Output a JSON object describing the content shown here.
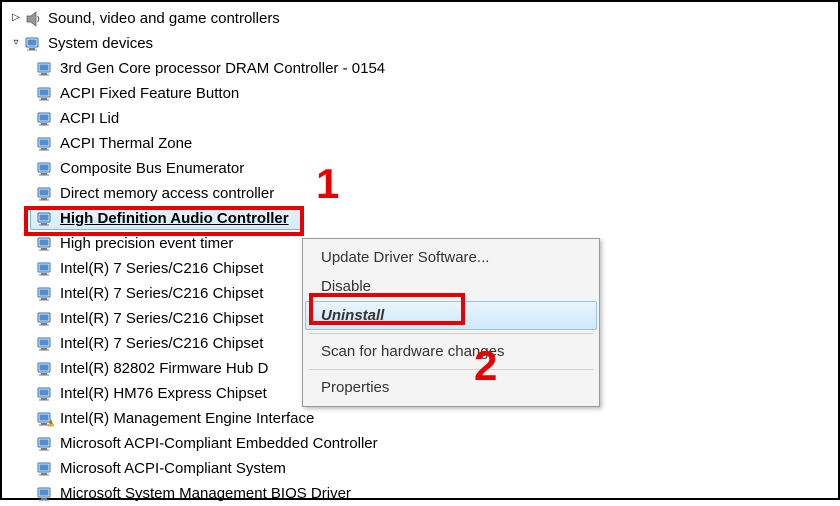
{
  "categories": [
    {
      "name": "Sound, video and game controllers",
      "expanded": false,
      "iconType": "speaker"
    },
    {
      "name": "System devices",
      "expanded": true,
      "iconType": "monitor"
    }
  ],
  "devices": [
    {
      "label": "3rd Gen Core processor DRAM Controller - 0154",
      "warn": false
    },
    {
      "label": "ACPI Fixed Feature Button",
      "warn": false
    },
    {
      "label": "ACPI Lid",
      "warn": false
    },
    {
      "label": "ACPI Thermal Zone",
      "warn": false
    },
    {
      "label": "Composite Bus Enumerator",
      "warn": false
    },
    {
      "label": "Direct memory access controller",
      "warn": false
    },
    {
      "label": "High Definition Audio Controller",
      "warn": false,
      "selected": true
    },
    {
      "label": "High precision event timer",
      "warn": false
    },
    {
      "label": "Intel(R) 7 Series/C216 Chipset ",
      "warn": false
    },
    {
      "label": "Intel(R) 7 Series/C216 Chipset ",
      "warn": false
    },
    {
      "label": "Intel(R) 7 Series/C216 Chipset ",
      "warn": false
    },
    {
      "label": "Intel(R) 7 Series/C216 Chipset ",
      "warn": false
    },
    {
      "label": "Intel(R) 82802 Firmware Hub D",
      "warn": false
    },
    {
      "label": "Intel(R) HM76 Express Chipset",
      "warn": false
    },
    {
      "label": "Intel(R) Management Engine Interface",
      "warn": true
    },
    {
      "label": "Microsoft ACPI-Compliant Embedded Controller",
      "warn": false
    },
    {
      "label": "Microsoft ACPI-Compliant System",
      "warn": false
    },
    {
      "label": "Microsoft System Management BIOS Driver",
      "warn": false
    }
  ],
  "contextMenu": {
    "items": [
      {
        "label": "Update Driver Software...",
        "hover": false
      },
      {
        "label": "Disable",
        "hover": false
      },
      {
        "label": "Uninstall",
        "hover": true
      },
      {
        "sep": true
      },
      {
        "label": "Scan for hardware changes",
        "hover": false
      },
      {
        "sep": true
      },
      {
        "label": "Properties",
        "hover": false
      }
    ]
  },
  "annotations": {
    "label1": "1",
    "label2": "2"
  }
}
